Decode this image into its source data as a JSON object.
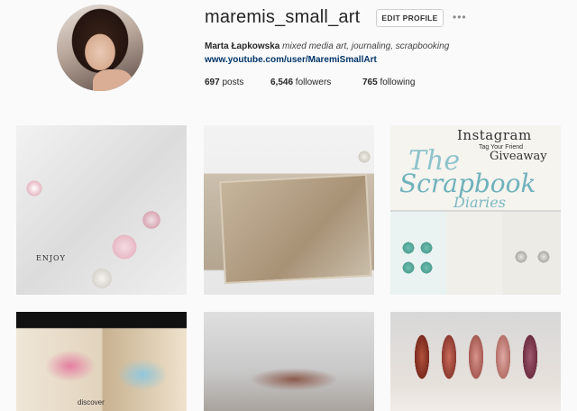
{
  "profile": {
    "username": "maremis_small_art",
    "edit_label": "EDIT PROFILE",
    "more_label": "•••",
    "name": "Marta Łapkowska",
    "bio": " mixed media art, journaling, scrapbooking",
    "website": "www.youtube.com/user/MaremiSmallArt",
    "posts_count": "697",
    "posts_label": " posts",
    "followers_count": "6,546",
    "followers_label": " followers",
    "following_count": "765",
    "following_label": " following"
  },
  "grid": {
    "tile1_text": "ENJOY",
    "tile3": {
      "title1": "Instagram",
      "title2": "Tag Your Friend",
      "title3": "Giveaway",
      "line1": "The",
      "line2": "Scrapbook",
      "line3": "Diaries"
    },
    "tile4_text": "discover"
  }
}
